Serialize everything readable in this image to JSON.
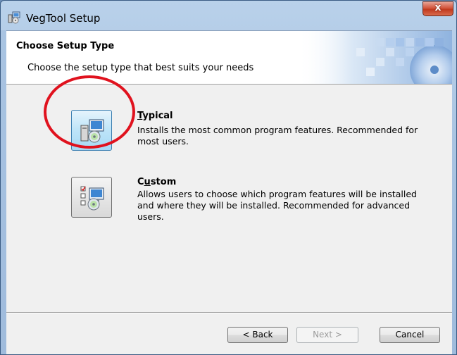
{
  "window": {
    "title": "VegTool Setup",
    "close_glyph": "x"
  },
  "header": {
    "title": "Choose Setup Type",
    "subtitle": "Choose the setup type that best suits your needs"
  },
  "options": [
    {
      "title_accel": "T",
      "title_rest": "ypical",
      "description_lines": [
        "Installs the most common program features. Recommended for",
        "most users."
      ],
      "icon": "setup-computer-icon"
    },
    {
      "title_pre": "C",
      "title_accel": "u",
      "title_rest": "stom",
      "description_lines": [
        "Allows users to choose which program features will be installed",
        "and where they will be installed. Recommended for advanced",
        "users."
      ],
      "icon": "custom-setup-icon"
    }
  ],
  "footer": {
    "back_label": "< Back",
    "next_label": "Next >",
    "cancel_label": "Cancel"
  },
  "colors": {
    "highlight_circle": "#e0121e",
    "hover_button": "#bde4f8"
  }
}
